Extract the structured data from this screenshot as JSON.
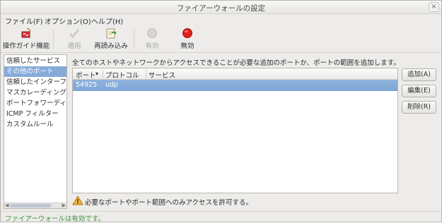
{
  "window": {
    "title": "ファイアーウォールの設定",
    "close_glyph": "×"
  },
  "menu": {
    "file": "ファイル(F)",
    "options": "オプション(O)",
    "help": "ヘルプ(H)"
  },
  "toolbar": {
    "wizard": {
      "label": "操作ガイド機能",
      "icon": "wizard-icon"
    },
    "apply": {
      "label": "適用",
      "icon": "checkmark-icon",
      "enabled": false
    },
    "reload": {
      "label": "再読み込み",
      "icon": "reload-icon"
    },
    "enable": {
      "label": "有効",
      "icon": "enable-icon",
      "enabled": false
    },
    "disable": {
      "label": "無効",
      "icon": "disable-icon",
      "color": "#e0201c"
    }
  },
  "sidebar": {
    "items": [
      {
        "label": "信頼したサービス"
      },
      {
        "label": "その他のポート",
        "selected": true
      },
      {
        "label": "信頼したインターフェイス"
      },
      {
        "label": "マスカレーディング"
      },
      {
        "label": "ポートフォワーディング"
      },
      {
        "label": "ICMP フィルター"
      },
      {
        "label": "カスタムルール"
      }
    ]
  },
  "main": {
    "description": "全てのホストやネットワークからアクセスできることが必要な追加のポートか、ポートの範囲を追加します。",
    "table": {
      "columns": [
        "ポート",
        "プロトコル",
        "サービス"
      ],
      "sort_glyph": "▾",
      "rows": [
        {
          "port": "54925",
          "protocol": "udp",
          "service": ""
        }
      ]
    },
    "buttons": {
      "add": "追加(A)",
      "edit": "編集(E)",
      "remove": "削除(R)"
    },
    "warning": "必要なポートやポート範囲へのみアクセスを許可する。"
  },
  "status": {
    "text": "ファイアーウォールは有効です。",
    "color": "#3f8f3f"
  },
  "accent_color": "#86abd9"
}
